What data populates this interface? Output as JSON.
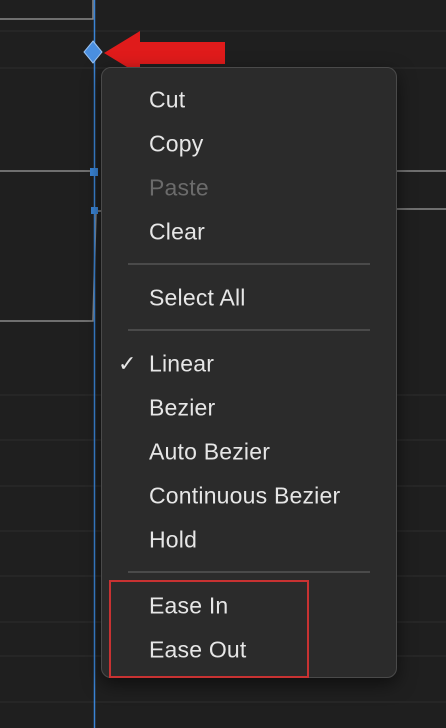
{
  "context_menu": {
    "items": [
      {
        "label": "Cut",
        "enabled": true
      },
      {
        "label": "Copy",
        "enabled": true
      },
      {
        "label": "Paste",
        "enabled": false
      },
      {
        "label": "Clear",
        "enabled": true
      },
      {
        "label": "Select All",
        "enabled": true
      },
      {
        "label": "Linear",
        "checked": true,
        "check_glyph": "✓"
      },
      {
        "label": "Bezier"
      },
      {
        "label": "Auto Bezier"
      },
      {
        "label": "Continuous Bezier"
      },
      {
        "label": "Hold"
      },
      {
        "label": "Ease In"
      },
      {
        "label": "Ease Out"
      }
    ]
  },
  "annotations": {
    "arrow_color": "#e01b1b",
    "highlight_color": "#c83232"
  },
  "colors": {
    "playhead": "#3a84d6",
    "keyframe": "#4a8fe0",
    "menu_bg": "#2b2b2b",
    "panel_bg": "#1f1f1f"
  }
}
